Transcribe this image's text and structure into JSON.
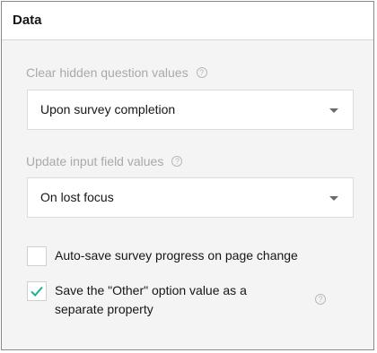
{
  "panel": {
    "title": "Data"
  },
  "clear_hidden": {
    "label": "Clear hidden question values",
    "help_icon": "question-circle-icon",
    "value": "Upon survey completion"
  },
  "update_input": {
    "label": "Update input field values",
    "help_icon": "question-circle-icon",
    "value": "On lost focus"
  },
  "autosave": {
    "label": "Auto-save survey progress on page change",
    "checked": false
  },
  "other_value": {
    "label_line1": "Save the \"Other\" option value as a",
    "label_line2": "separate property",
    "checked": true,
    "help_icon": "question-circle-icon"
  },
  "colors": {
    "accent": "#19b394",
    "label_muted": "#a9a9a9",
    "text": "#161616",
    "background": "#f4f4f4"
  }
}
